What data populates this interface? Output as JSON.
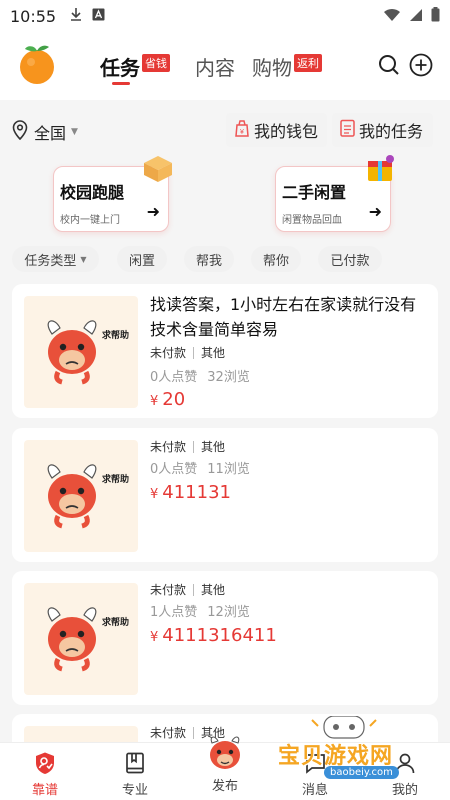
{
  "status_bar": {
    "time": "10:55",
    "icons": [
      "download-icon",
      "a-icon",
      "wifi-icon",
      "signal-icon",
      "battery-icon"
    ]
  },
  "header": {
    "tabs": [
      {
        "label": "任务",
        "tag": "省钱",
        "active": true
      },
      {
        "label": "内容",
        "tag": "",
        "active": false
      },
      {
        "label": "购物",
        "tag": "返利",
        "active": false
      }
    ],
    "icons": [
      "search-icon",
      "add-icon"
    ]
  },
  "location": {
    "label": "全国"
  },
  "wallet_button": "我的钱包",
  "mytask_button": "我的任务",
  "features": [
    {
      "title": "校园跑腿",
      "subtitle": "校内一键上门"
    },
    {
      "title": "二手闲置",
      "subtitle": "闲置物品回血"
    }
  ],
  "filters": {
    "task_type": "任务类型",
    "chips": [
      "闲置",
      "帮我",
      "帮你",
      "已付款"
    ]
  },
  "tasks": [
    {
      "title": "找读答案，1小时左右在家读就行没有技术含量简单容易",
      "status": "未付款",
      "category": "其他",
      "likes": "0人点赞",
      "views": "32浏览",
      "currency": "¥",
      "price": "20"
    },
    {
      "title": "",
      "status": "未付款",
      "category": "其他",
      "likes": "0人点赞",
      "views": "11浏览",
      "currency": "¥",
      "price": "411131"
    },
    {
      "title": "",
      "status": "未付款",
      "category": "其他",
      "likes": "1人点赞",
      "views": "12浏览",
      "currency": "¥",
      "price": "4111316411"
    },
    {
      "title": "",
      "status": "未付款",
      "category": "其他",
      "likes": "",
      "views": "",
      "currency": "",
      "price": ""
    }
  ],
  "thumb_text": "求帮助",
  "bottom_nav": [
    {
      "label": "靠谱",
      "active": true
    },
    {
      "label": "专业",
      "active": false
    },
    {
      "label": "发布",
      "active": false
    },
    {
      "label": "消息",
      "active": false
    },
    {
      "label": "我的",
      "active": false
    }
  ],
  "watermark": {
    "text": "宝贝游戏网",
    "url": "baobeiy.com"
  },
  "colors": {
    "accent": "#e53935",
    "price": "#e53935",
    "watermark": "#f5a623"
  }
}
